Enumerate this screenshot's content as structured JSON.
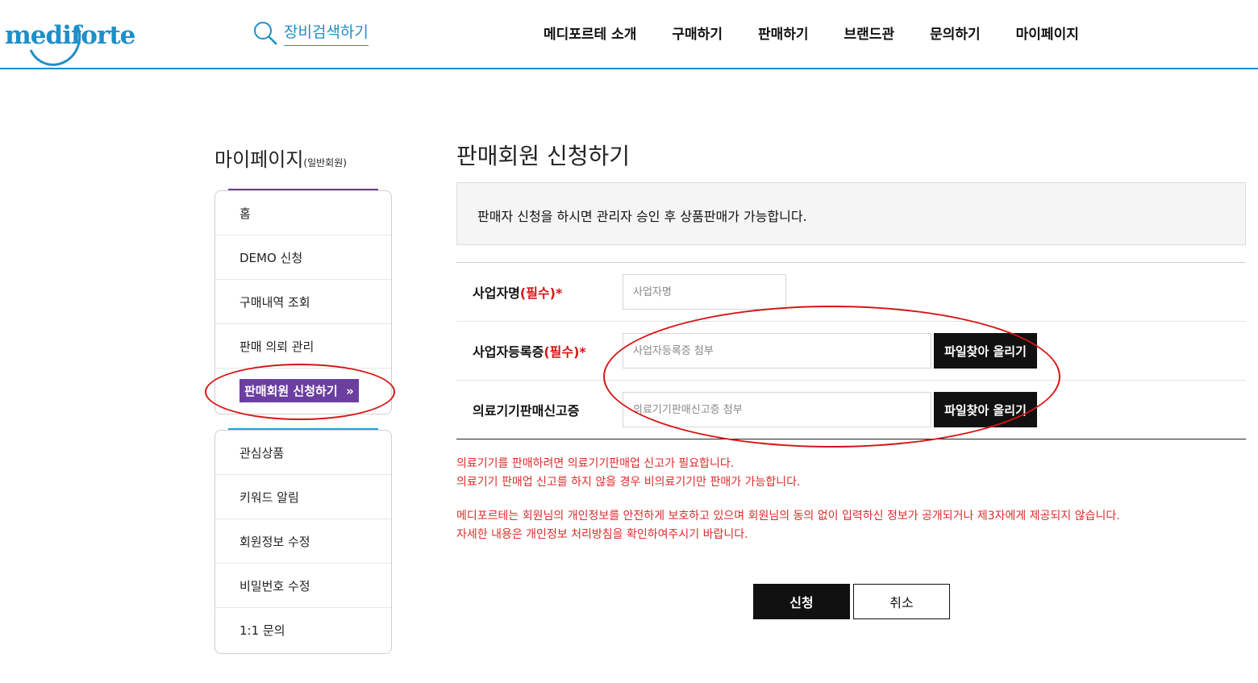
{
  "brand": {
    "logo_text": "mediforte",
    "accent": "#1d8fc9",
    "purple": "#6b3fa0",
    "alert_red": "#e02a2a"
  },
  "header": {
    "search_label": "장비검색하기",
    "nav": [
      "메디포르테 소개",
      "구매하기",
      "판매하기",
      "브랜드관",
      "문의하기",
      "마이페이지"
    ]
  },
  "sidebar": {
    "title": "마이페이지",
    "subtitle": "(일반회원)",
    "group1": [
      "홈",
      "DEMO 신청",
      "구매내역 조회",
      "판매 의뢰 관리",
      "판매회원 신청하기"
    ],
    "active_arrow": "»",
    "group2": [
      "관심상품",
      "키워드 알림",
      "회원정보 수정",
      "비밀번호 수정",
      "1:1 문의"
    ]
  },
  "main": {
    "title": "판매회원 신청하기",
    "notice": "판매자 신청을 하시면 관리자 승인 후 상품판매가 가능합니다.",
    "required_mark": "(필수)*",
    "fields": [
      {
        "label": "사업자명",
        "placeholder": "사업자명"
      },
      {
        "label": "사업자등록증",
        "placeholder": "사업자등록증 첨부",
        "button": "파일찾아 올리기"
      },
      {
        "label": "의료기기판매신고증",
        "placeholder": "의료기기판매신고증 첨부",
        "button": "파일찾아 올리기"
      }
    ],
    "warnings": [
      "의료기기를 판매하려면 의료기기판매업 신고가 필요합니다.",
      "의료기기 판매업 신고를 하지 않을 경우 비의료기기만 판매가 가능합니다.",
      "메디포르테는 회원님의 개인정보를 안전하게 보호하고 있으며 회원님의 동의 없이 입력하신 정보가 공개되거나 제3자에게 제공되지 않습니다.",
      "자세한 내용은 개인정보 처리방침을 확인하여주시기 바랍니다."
    ],
    "submit_label": "신청",
    "cancel_label": "취소"
  }
}
